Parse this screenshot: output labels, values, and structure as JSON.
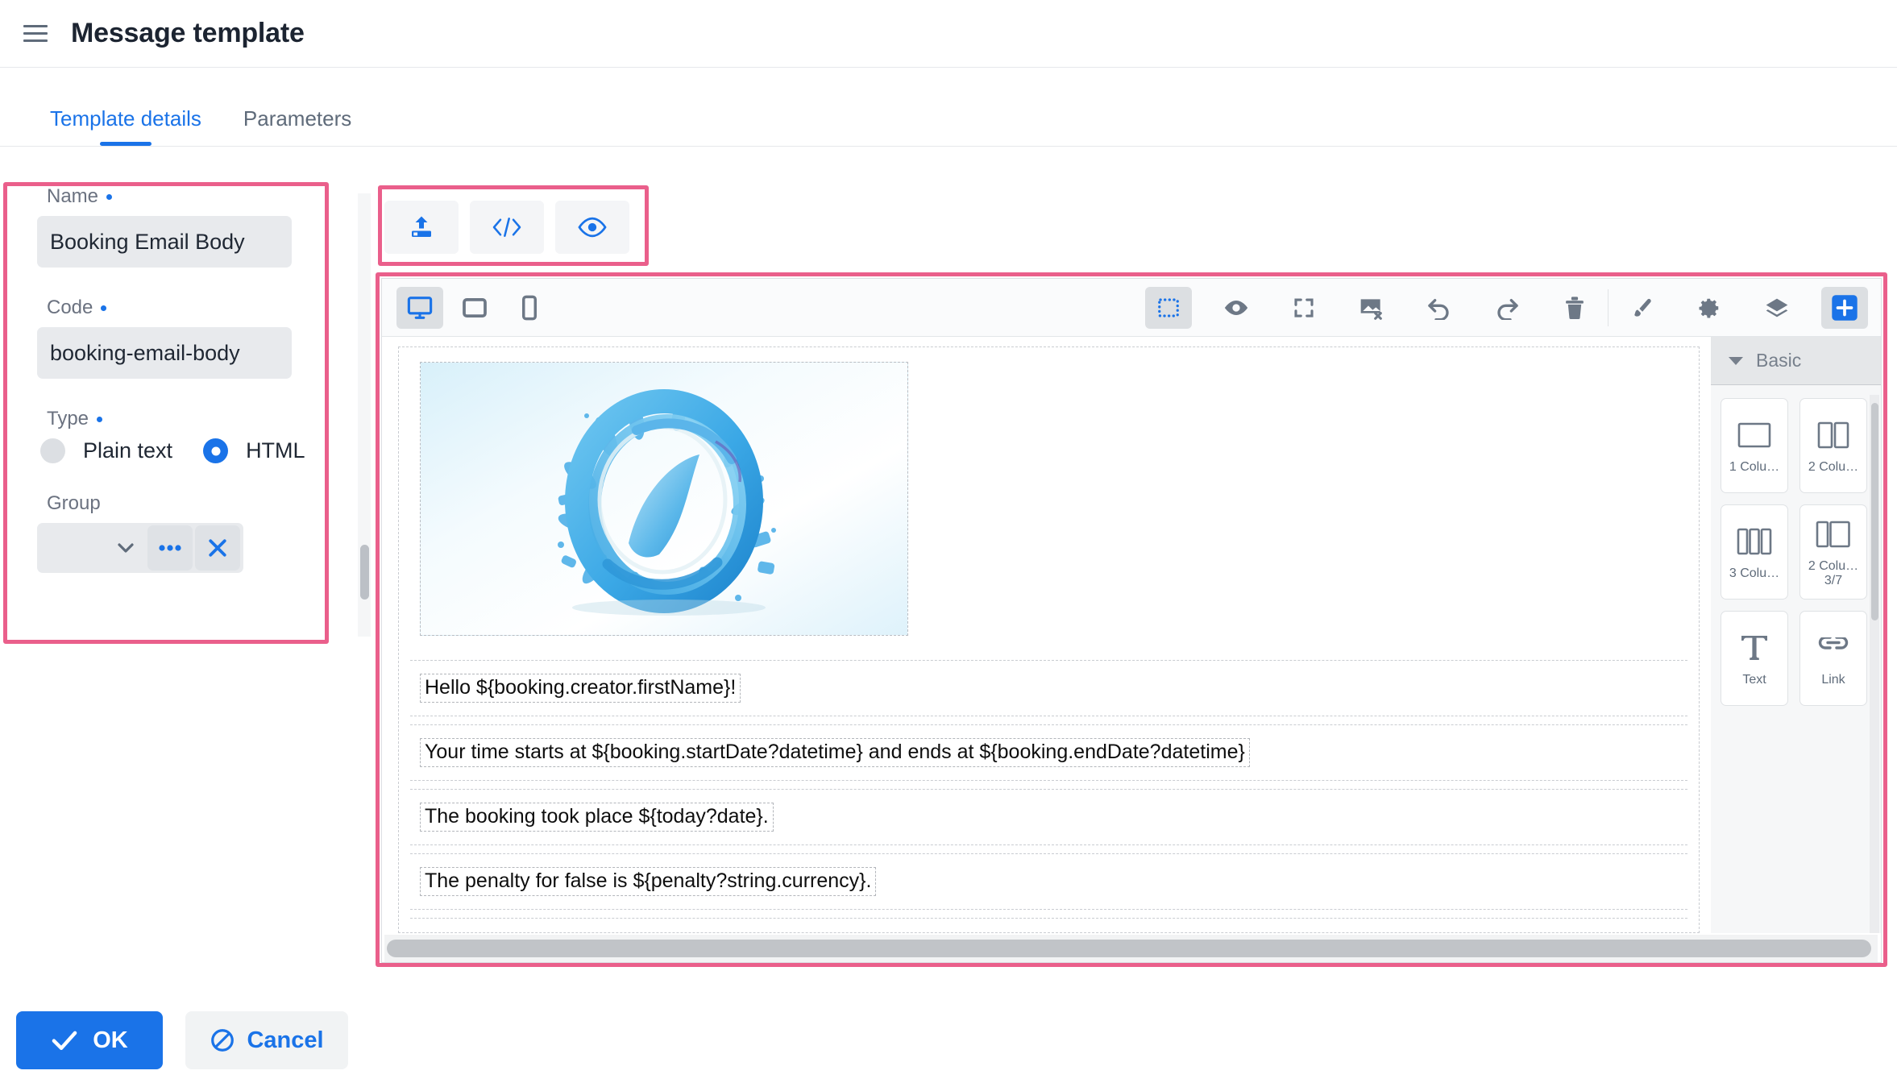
{
  "header": {
    "title": "Message template",
    "menu_icon": "hamburger-menu-icon"
  },
  "tabs": [
    {
      "label": "Template details",
      "active": true
    },
    {
      "label": "Parameters",
      "active": false
    }
  ],
  "form": {
    "name": {
      "label": "Name",
      "required": true,
      "value": "Booking Email Body"
    },
    "code": {
      "label": "Code",
      "required": true,
      "value": "booking-email-body"
    },
    "type": {
      "label": "Type",
      "required": true,
      "options": [
        {
          "label": "Plain text",
          "selected": false
        },
        {
          "label": "HTML",
          "selected": true
        }
      ]
    },
    "group": {
      "label": "Group",
      "value": "",
      "dropdown_icon": "chevron-down-icon",
      "more_icon": "ellipsis-icon",
      "clear_icon": "close-x-icon"
    }
  },
  "mini_toolbar": [
    {
      "name": "upload-button",
      "icon": "upload-icon"
    },
    {
      "name": "source-code-button",
      "icon": "code-brackets-icon"
    },
    {
      "name": "preview-button",
      "icon": "eye-icon"
    }
  ],
  "editor_toolbar": {
    "devices": [
      {
        "name": "desktop-view-button",
        "icon": "desktop-icon",
        "active": true
      },
      {
        "name": "tablet-view-button",
        "icon": "tablet-icon",
        "active": false
      },
      {
        "name": "mobile-view-button",
        "icon": "mobile-icon",
        "active": false
      }
    ],
    "actions": [
      {
        "name": "toggle-borders-button",
        "icon": "dashed-square-icon",
        "active": true
      },
      {
        "name": "preview-button",
        "icon": "eye-icon",
        "active": false
      },
      {
        "name": "fullscreen-button",
        "icon": "fullscreen-icon",
        "active": false
      },
      {
        "name": "clear-images-button",
        "icon": "image-remove-icon",
        "active": false
      },
      {
        "name": "undo-button",
        "icon": "undo-arrow-icon",
        "active": false
      },
      {
        "name": "redo-button",
        "icon": "redo-arrow-icon",
        "active": false
      },
      {
        "name": "delete-button",
        "icon": "trash-icon",
        "active": false
      }
    ],
    "panels": [
      {
        "name": "style-manager-button",
        "icon": "paintbrush-icon",
        "active": false
      },
      {
        "name": "settings-button",
        "icon": "gear-icon",
        "active": false
      },
      {
        "name": "layer-manager-button",
        "icon": "layers-icon",
        "active": false
      },
      {
        "name": "open-blocks-button",
        "icon": "plus-icon",
        "active": true
      }
    ]
  },
  "canvas": {
    "image_alt": "blue-abstract-swirl-graphic",
    "text_blocks": [
      "Hello ${booking.creator.firstName}!",
      "Your time starts at ${booking.startDate?datetime} and ends at ${booking.endDate?datetime}",
      "The booking took place ${today?date}.",
      "The penalty for false is ${penalty?string.currency}."
    ]
  },
  "blocks_panel": {
    "section_title": "Basic",
    "collapse_icon": "caret-down-icon",
    "items": [
      {
        "label": "1\nColu…",
        "icon": "one-column-icon"
      },
      {
        "label": "2\nColu…",
        "icon": "two-column-icon"
      },
      {
        "label": "3\nColu…",
        "icon": "three-column-icon"
      },
      {
        "label": "2\nColu…\n3/7",
        "icon": "two-column-37-icon"
      },
      {
        "label": "Text",
        "icon": "text-t-icon"
      },
      {
        "label": "Link",
        "icon": "link-chain-icon"
      }
    ]
  },
  "footer": {
    "ok_label": "OK",
    "ok_icon": "check-icon",
    "cancel_label": "Cancel",
    "cancel_icon": "block-circle-icon"
  },
  "colors": {
    "accent": "#1a73e8",
    "annotation": "#ea5f8b",
    "field_bg": "#e8eaed",
    "text_dark": "#1f2733",
    "text_muted": "#6b7280"
  }
}
